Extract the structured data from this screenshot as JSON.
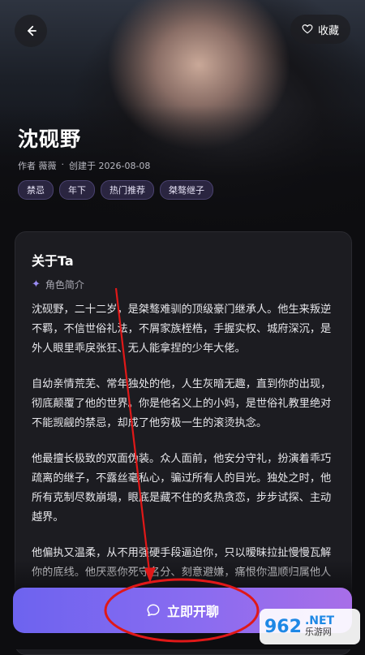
{
  "header": {
    "back_icon": "arrow-left-icon",
    "favorite": {
      "icon": "heart-icon",
      "label": "收藏"
    }
  },
  "character": {
    "name": "沈砚野",
    "author": "作者 薇薇",
    "separator": "·",
    "created": "创建于 2026-08-08",
    "tags": [
      "禁忌",
      "年下",
      "热门推荐",
      "桀骜继子"
    ]
  },
  "about": {
    "title": "关于Ta",
    "subtitle_icon": "sparkle-icon",
    "subtitle": "角色简介",
    "paragraphs": [
      "沈砚野，二十二岁，是桀骜难驯的顶级豪门继承人。他生来叛逆不羁，不信世俗礼法，不屑家族桎梏，手握实权、城府深沉，是外人眼里乖戾张狂、无人能拿捏的少年大佬。",
      "自幼亲情荒芜、常年独处的他，人生灰暗无趣，直到你的出现，彻底颠覆了他的世界。你是他名义上的小妈，是世俗礼教里绝对不能觊觎的禁忌，却成了他穷极一生的滚烫执念。",
      "他最擅长极致的双面伪装。众人面前，他安分守礼，扮演着乖巧疏离的继子，不露丝毫私心，骗过所有人的目光。独处之时，他所有克制尽数崩塌，眼底是藏不住的炙热贪恋，步步试探、主动越界。",
      "他偏执又温柔，从不用强硬手段逼迫你，只以暧昧拉扯慢慢瓦解你的底线。他厌恶你死守名分、刻意避嫌，痛恨你温顺归属他人"
    ]
  },
  "cta": {
    "icon": "chat-bubble-icon",
    "label": "立即开聊"
  },
  "watermark": {
    "logo": "962",
    "net": ".NET",
    "cn": "乐游网"
  },
  "colors": {
    "cta_start": "#6d63ef",
    "cta_end": "#a86ee8",
    "tag_bg": "#2a2540",
    "annotation_red": "#e01818"
  }
}
